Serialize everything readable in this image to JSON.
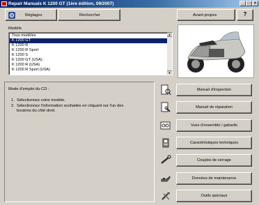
{
  "window": {
    "title": "Repair Manuals K 1200 GT (1ère édition, 09/2007)",
    "minimize": "_",
    "maximize": "□",
    "close": "×"
  },
  "toolbar": {
    "settings_label": "Réglages",
    "search_label": "Rechercher",
    "foreword_label": "Avant-propos",
    "help_label": "?"
  },
  "model_section": {
    "label": "Modèle",
    "items": [
      {
        "label": "Tous modèles",
        "selected": false
      },
      {
        "label": "K 1200 GT",
        "selected": true
      },
      {
        "label": "K 1200 R",
        "selected": false
      },
      {
        "label": "K 1200 R Sport",
        "selected": false
      },
      {
        "label": "K 1200 S",
        "selected": false
      },
      {
        "label": "K 1200 GT (USA)",
        "selected": false
      },
      {
        "label": "K 1200 R (USA)",
        "selected": false
      },
      {
        "label": "K 1200 R Sport (USA)",
        "selected": false
      }
    ]
  },
  "instructions": {
    "heading": "Mode d'emploi du CD :",
    "step1_num": "1.",
    "step1": "Sélectionnez votre modèle.",
    "step2_num": "2.",
    "step2_line1": "Sélectionnez l'information souhaitée en cliquant sur l'un des",
    "step2_line2": "boutons du côté droit."
  },
  "manuals": [
    {
      "label": "Manuel d'inspection",
      "icon": "inspection-icon"
    },
    {
      "label": "Manuel de réparation",
      "icon": "repair-icon"
    },
    {
      "label": "Vues d'ensemble / gabarits",
      "icon": "overview-icon"
    },
    {
      "label": "Caractéristiques techniques",
      "icon": "specs-icon"
    },
    {
      "label": "Couples de serrage",
      "icon": "torque-wrench-icon"
    },
    {
      "label": "Données de maintenance",
      "icon": "oil-can-icon"
    },
    {
      "label": "Outils spéciaux",
      "icon": "special-tools-icon"
    }
  ],
  "colors": {
    "title_bar": "#0a246a",
    "selection": "#0a246a",
    "face": "#d4d0c8"
  }
}
